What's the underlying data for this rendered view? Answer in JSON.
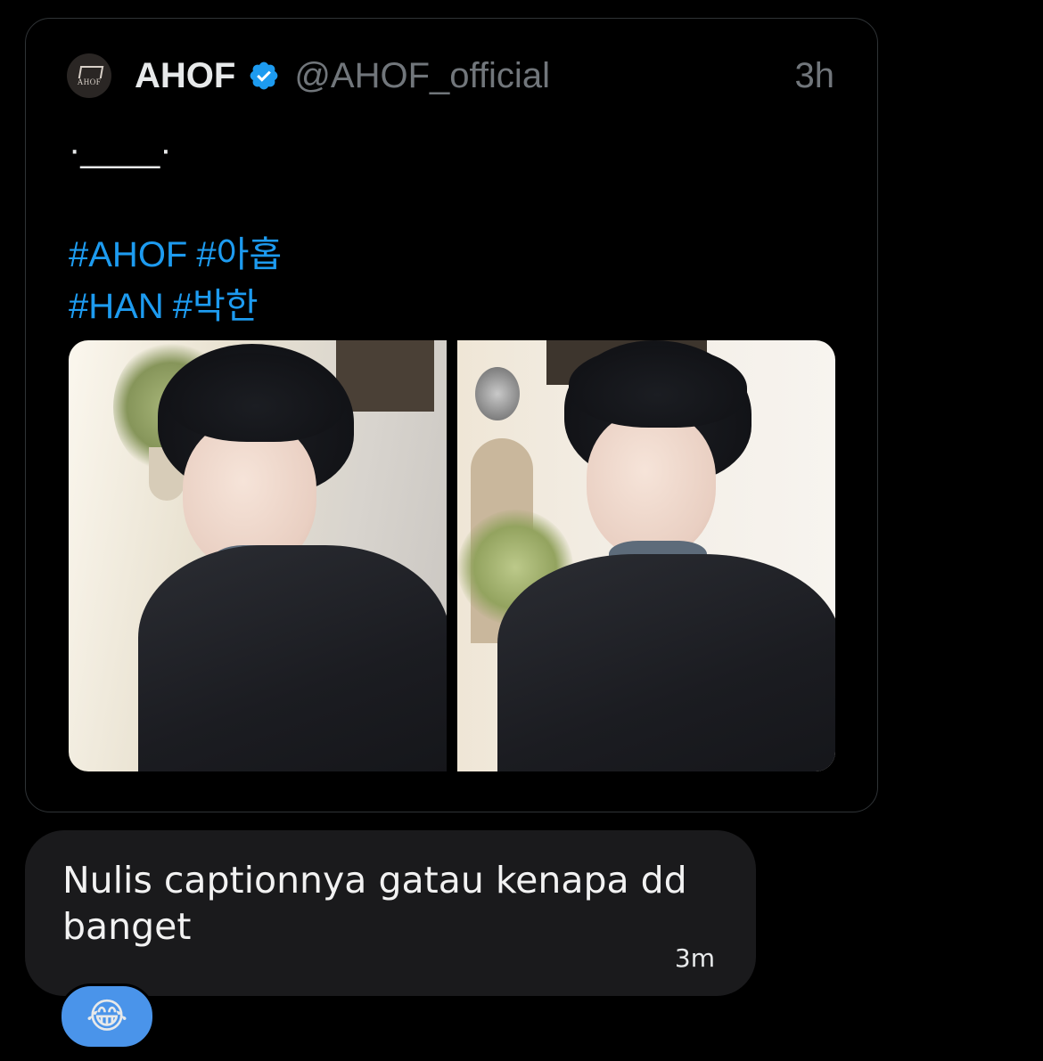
{
  "quoted_tweet": {
    "avatar_text": "AHOF",
    "display_name": "AHOF",
    "handle": "@AHOF_official",
    "timestamp": "3h",
    "text": "·____·",
    "hashtags_line1": [
      "#AHOF",
      "#아홉"
    ],
    "hashtags_line2": [
      "#HAN",
      "#박한"
    ],
    "media_count": 2
  },
  "reply": {
    "text": "Nulis captionnya gatau kenapa dd banget",
    "timestamp": "3m"
  },
  "reaction": {
    "emoji": "😂",
    "icon": "laughing-tears-emoji"
  },
  "colors": {
    "background": "#000000",
    "link": "#1d9bf0",
    "secondary_text": "#71767b",
    "bubble": "#1a1a1c",
    "reaction": "#4a94ea"
  }
}
